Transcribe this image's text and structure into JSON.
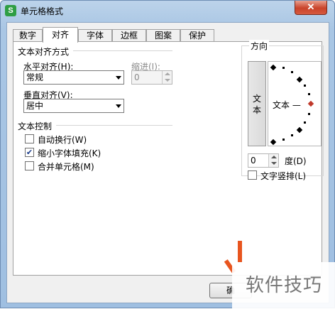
{
  "window": {
    "title": "单元格格式",
    "app_icon_glyph": "S",
    "close_label": "✕"
  },
  "tabs": [
    "数字",
    "对齐",
    "字体",
    "边框",
    "图案",
    "保护"
  ],
  "active_tab": "对齐",
  "text_alignment": {
    "group_title": "文本对齐方式",
    "horizontal_label": "水平对齐(H):",
    "horizontal_value": "常规",
    "indent_label": "缩进(I):",
    "indent_value": "0",
    "vertical_label": "垂直对齐(V):",
    "vertical_value": "居中"
  },
  "text_control": {
    "group_title": "文本控制",
    "wrap_text": {
      "label": "自动换行(W)",
      "checked": false
    },
    "shrink_to_fit": {
      "label": "缩小字体填充(K)",
      "checked": true
    },
    "merge_cells": {
      "label": "合并单元格(M)",
      "checked": false
    }
  },
  "orientation": {
    "group_title": "方向",
    "vertical_text_chars": [
      "文",
      "本"
    ],
    "dial_text": "文本 —",
    "degree_value": "0",
    "degree_label": "度(D)",
    "stacked_text": {
      "label": "文字竖排(L)",
      "checked": false
    }
  },
  "footer": {
    "ok_label": "确"
  },
  "watermark": {
    "text": "软件技巧"
  },
  "colors": {
    "active_marker": "#c0392b",
    "checkmark": "#1a3c8a",
    "watermark_accent": "#e8551f"
  }
}
